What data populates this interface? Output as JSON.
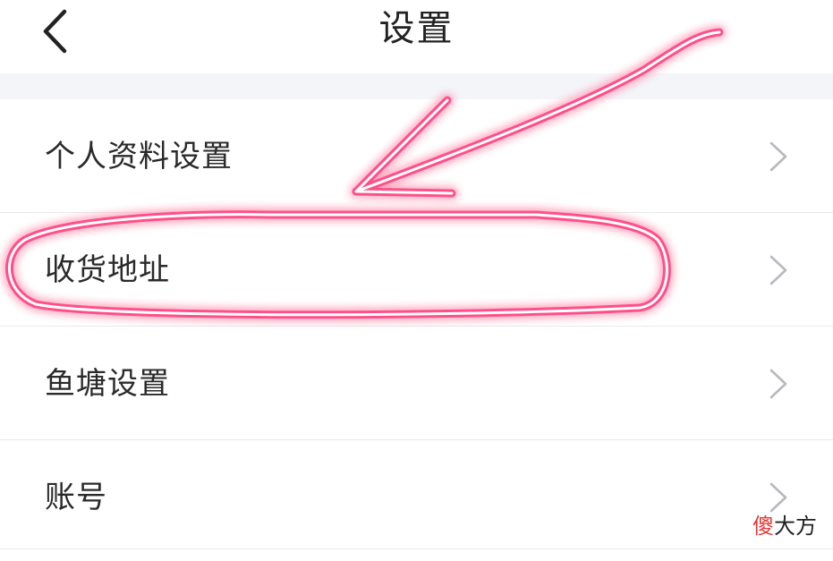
{
  "nav": {
    "title": "设置",
    "back_icon": "chevron-left-icon"
  },
  "settings": {
    "items": [
      {
        "label": "个人资料设置",
        "icon": "chevron-right-icon"
      },
      {
        "label": "收货地址",
        "icon": "chevron-right-icon",
        "highlighted": true
      },
      {
        "label": "鱼塘设置",
        "icon": "chevron-right-icon"
      },
      {
        "label": "账号",
        "icon": "chevron-right-icon"
      }
    ]
  },
  "annotation": {
    "color": "#ff4f8b",
    "shapes": [
      "arrow",
      "ellipse-outline"
    ]
  },
  "watermark": {
    "first_char": "傻",
    "rest": "大方",
    "first_color": "#e53935"
  }
}
